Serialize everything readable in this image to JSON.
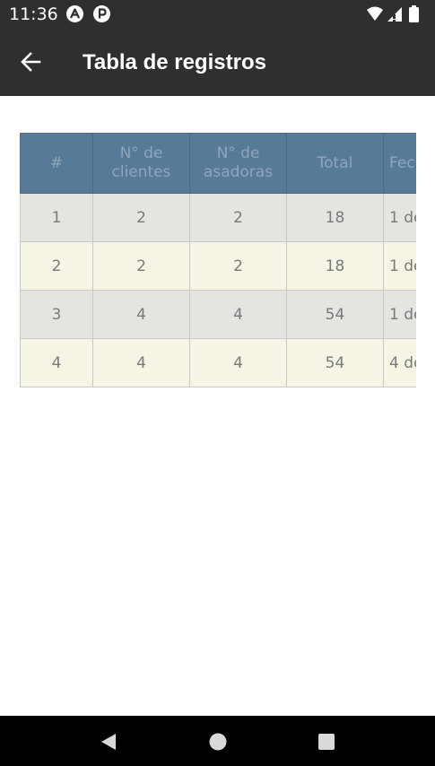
{
  "status_bar": {
    "time": "11:36",
    "icons": [
      "notification-a-icon",
      "notification-p-icon",
      "wifi-icon",
      "signal-icon",
      "battery-icon"
    ]
  },
  "app_bar": {
    "title": "Tabla de registros",
    "back_icon": "arrow-left-icon"
  },
  "table": {
    "columns": [
      "#",
      "N° de clientes",
      "N° de asadoras",
      "Total",
      "Fec"
    ],
    "rows": [
      [
        "1",
        "2",
        "2",
        "18",
        "1 de"
      ],
      [
        "2",
        "2",
        "2",
        "18",
        "1 de"
      ],
      [
        "3",
        "4",
        "4",
        "54",
        "1 de"
      ],
      [
        "4",
        "4",
        "4",
        "54",
        "4 de"
      ]
    ],
    "colors": {
      "header_bg": "#587a99",
      "row_odd_bg": "#e5e4e1",
      "row_even_bg": "#f6f4e4"
    }
  },
  "nav_bar": {
    "buttons": [
      "back-triangle-icon",
      "home-circle-icon",
      "recents-square-icon"
    ]
  },
  "colors": {
    "app_bar_bg": "#2f2f2f",
    "nav_bar_bg": "#000000"
  }
}
